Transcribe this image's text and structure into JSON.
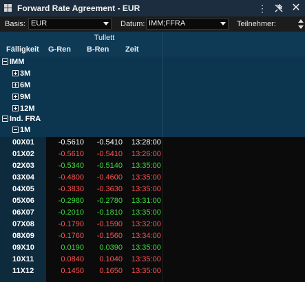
{
  "window": {
    "title": "Forward Rate Agreement - EUR"
  },
  "toolbar": {
    "basis_label": "Basis:",
    "basis_value": "EUR",
    "datum_label": "Datum:",
    "datum_value": "IMM;FFRA",
    "teilnehmer_label": "Teilnehmer:"
  },
  "grid": {
    "group_header": "Tullett",
    "columns": {
      "faelligkeit": "Fälligkeit",
      "g_ren": "G-Ren",
      "b_ren": "B-Ren",
      "zeit": "Zeit"
    },
    "tree": {
      "imm": "IMM",
      "m3": "3M",
      "m6": "6M",
      "m9": "9M",
      "m12": "12M",
      "ind_fra": "Ind. FRA",
      "m1": "1M"
    },
    "rows": [
      {
        "tenor": "00X01",
        "g": "-0.5610",
        "b": "-0.5410",
        "zeit": "13:28:00",
        "color": "white"
      },
      {
        "tenor": "01X02",
        "g": "-0.5610",
        "b": "-0.5410",
        "zeit": "13:26:00",
        "color": "red"
      },
      {
        "tenor": "02X03",
        "g": "-0.5340",
        "b": "-0.5140",
        "zeit": "13:35:00",
        "color": "green"
      },
      {
        "tenor": "03X04",
        "g": "-0.4800",
        "b": "-0.4600",
        "zeit": "13:35:00",
        "color": "red"
      },
      {
        "tenor": "04X05",
        "g": "-0.3830",
        "b": "-0.3630",
        "zeit": "13:35:00",
        "color": "red"
      },
      {
        "tenor": "05X06",
        "g": "-0.2980",
        "b": "-0.2780",
        "zeit": "13:31:00",
        "color": "green"
      },
      {
        "tenor": "06X07",
        "g": "-0.2010",
        "b": "-0.1810",
        "zeit": "13:35:00",
        "color": "green"
      },
      {
        "tenor": "07X08",
        "g": "-0.1790",
        "b": "-0.1590",
        "zeit": "13:32:00",
        "color": "red"
      },
      {
        "tenor": "08X09",
        "g": "-0.1760",
        "b": "-0.1560",
        "zeit": "13:34:00",
        "color": "red"
      },
      {
        "tenor": "09X10",
        "g": "0.0190",
        "b": "0.0390",
        "zeit": "13:35:00",
        "color": "green"
      },
      {
        "tenor": "10X11",
        "g": "0.0840",
        "b": "0.1040",
        "zeit": "13:35:00",
        "color": "red"
      },
      {
        "tenor": "11X12",
        "g": "0.1450",
        "b": "0.1650",
        "zeit": "13:35:00",
        "color": "red"
      }
    ]
  },
  "colors": {
    "title_bg": "#1b2d3e",
    "header_bg": "#0f3a56",
    "up": "#3ddc3d",
    "down": "#ff5454"
  }
}
